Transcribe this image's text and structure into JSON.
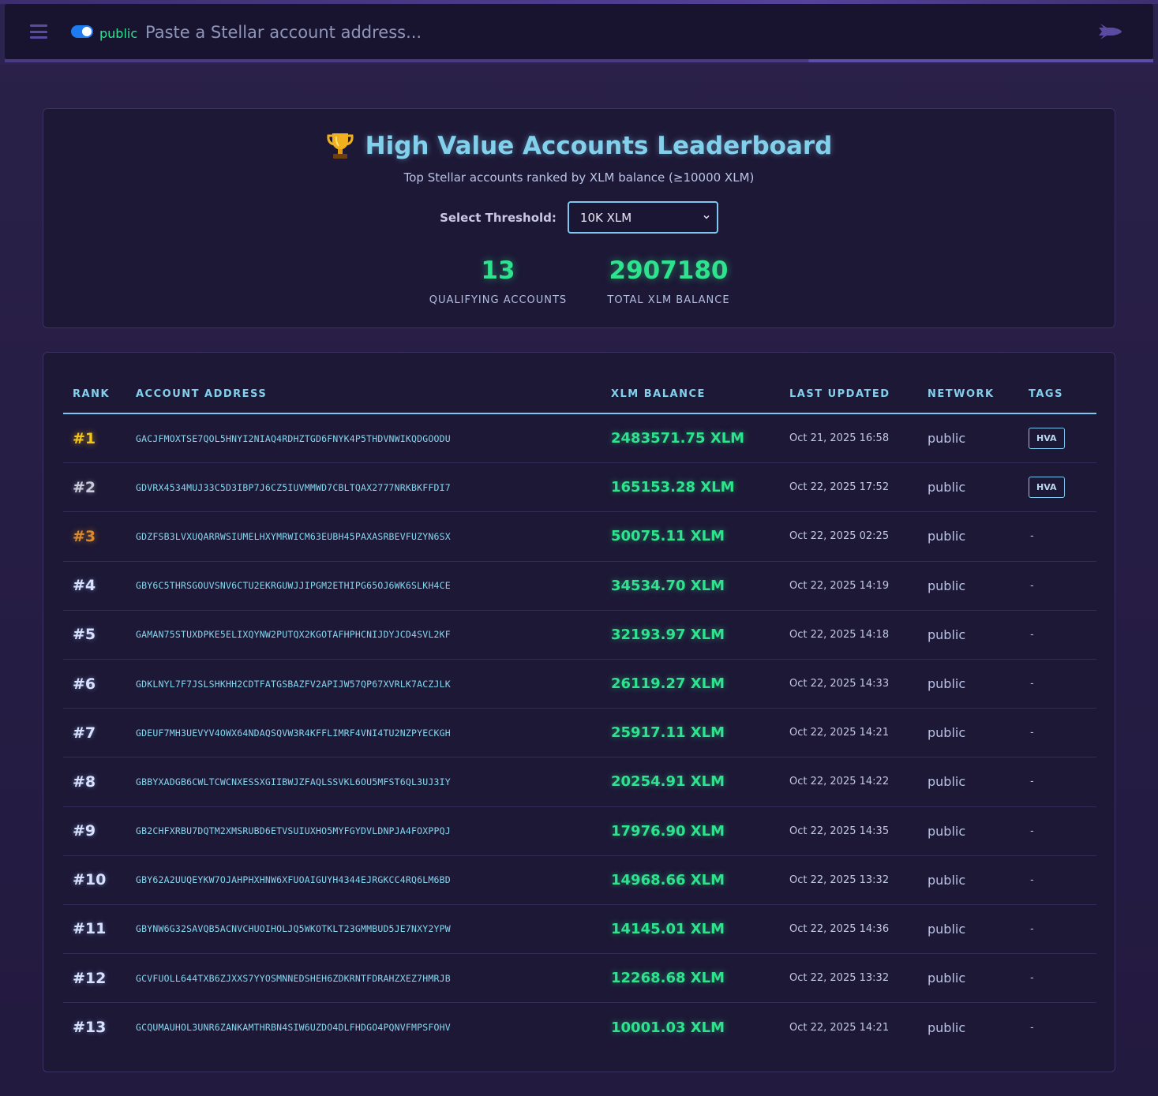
{
  "header": {
    "network_label": "public",
    "search_placeholder": "Paste a Stellar account address..."
  },
  "leaderboard": {
    "title": "High Value Accounts Leaderboard",
    "subtitle": "Top Stellar accounts ranked by XLM balance (≥10000 XLM)",
    "threshold_label": "Select Threshold:",
    "threshold_value": "10K XLM",
    "stats": {
      "qualifying_value": "13",
      "qualifying_label": "QUALIFYING ACCOUNTS",
      "total_value": "2907180",
      "total_label": "TOTAL XLM BALANCE"
    }
  },
  "table": {
    "columns": [
      "RANK",
      "ACCOUNT ADDRESS",
      "XLM BALANCE",
      "LAST UPDATED",
      "NETWORK",
      "TAGS"
    ],
    "rows": [
      {
        "rank": "#1",
        "address": "GACJFMOXTSE7QOL5HNYI2NIAQ4RDHZTGD6FNYK4P5THDVNWIKQDGOODU",
        "balance": "2483571.75 XLM",
        "updated": "Oct 21, 2025 16:58",
        "network": "public",
        "tag": "HVA"
      },
      {
        "rank": "#2",
        "address": "GDVRX4534MUJ33C5D3IBP7J6CZ5IUVMMWD7CBLTQAX2777NRKBKFFDI7",
        "balance": "165153.28 XLM",
        "updated": "Oct 22, 2025 17:52",
        "network": "public",
        "tag": "HVA"
      },
      {
        "rank": "#3",
        "address": "GDZFSB3LVXUQARRWSIUMELHXYMRWICM63EUBH45PAXASRBEVFUZYN6SX",
        "balance": "50075.11 XLM",
        "updated": "Oct 22, 2025 02:25",
        "network": "public",
        "tag": "-"
      },
      {
        "rank": "#4",
        "address": "GBY6C5THRSGOUVSNV6CTU2EKRGUWJJIPGM2ETHIPG65OJ6WK6SLKH4CE",
        "balance": "34534.70 XLM",
        "updated": "Oct 22, 2025 14:19",
        "network": "public",
        "tag": "-"
      },
      {
        "rank": "#5",
        "address": "GAMAN75STUXDPKE5ELIXQYNW2PUTQX2KGOTAFHPHCNIJDYJCD4SVL2KF",
        "balance": "32193.97 XLM",
        "updated": "Oct 22, 2025 14:18",
        "network": "public",
        "tag": "-"
      },
      {
        "rank": "#6",
        "address": "GDKLNYL7F7JSLSHKHH2CDTFATGSBAZFV2APIJW57QP67XVRLK7ACZJLK",
        "balance": "26119.27 XLM",
        "updated": "Oct 22, 2025 14:33",
        "network": "public",
        "tag": "-"
      },
      {
        "rank": "#7",
        "address": "GDEUF7MH3UEVYV4OWX64NDAQSQVW3R4KFFLIMRF4VNI4TU2NZPYECKGH",
        "balance": "25917.11 XLM",
        "updated": "Oct 22, 2025 14:21",
        "network": "public",
        "tag": "-"
      },
      {
        "rank": "#8",
        "address": "GBBYXADGB6CWLTCWCNXESSXGIIBWJZFAQLSSVKL6OU5MFST6QL3UJ3IY",
        "balance": "20254.91 XLM",
        "updated": "Oct 22, 2025 14:22",
        "network": "public",
        "tag": "-"
      },
      {
        "rank": "#9",
        "address": "GB2CHFXRBU7DQTM2XMSRUBD6ETVSUIUXHO5MYFGYDVLDNPJA4FOXPPQJ",
        "balance": "17976.90 XLM",
        "updated": "Oct 22, 2025 14:35",
        "network": "public",
        "tag": "-"
      },
      {
        "rank": "#10",
        "address": "GBY62A2UUQEYKW7OJAHPHXHNW6XFUOAIGUYH4344EJRGKCC4RQ6LM6BD",
        "balance": "14968.66 XLM",
        "updated": "Oct 22, 2025 13:32",
        "network": "public",
        "tag": "-"
      },
      {
        "rank": "#11",
        "address": "GBYNW6G32SAVQB5ACNVCHUOIHOLJQ5WKOTKLT23GMMBUD5JE7NXY2YPW",
        "balance": "14145.01 XLM",
        "updated": "Oct 22, 2025 14:36",
        "network": "public",
        "tag": "-"
      },
      {
        "rank": "#12",
        "address": "GCVFUOLL644TXB6ZJXXS7YYOSMNNEDSHEH6ZDKRNTFDRAHZXEZ7HMRJB",
        "balance": "12268.68 XLM",
        "updated": "Oct 22, 2025 13:32",
        "network": "public",
        "tag": "-"
      },
      {
        "rank": "#13",
        "address": "GCQUMAUHOL3UNR6ZANKAMTHRBN4SIW6UZDO4DLFHDGO4PQNVFMPSFOHV",
        "balance": "10001.03 XLM",
        "updated": "Oct 22, 2025 14:21",
        "network": "public",
        "tag": "-"
      }
    ]
  },
  "colors": {
    "accent": "#83d0ec",
    "balance_green": "#2de38d",
    "rank_gold": "#f5c518",
    "rank_silver": "#c9ccd8",
    "rank_bronze": "#d98a2b"
  },
  "icons": [
    "menu-icon",
    "network-toggle",
    "rocket-icon",
    "trophy-icon",
    "chevron-down-icon"
  ]
}
